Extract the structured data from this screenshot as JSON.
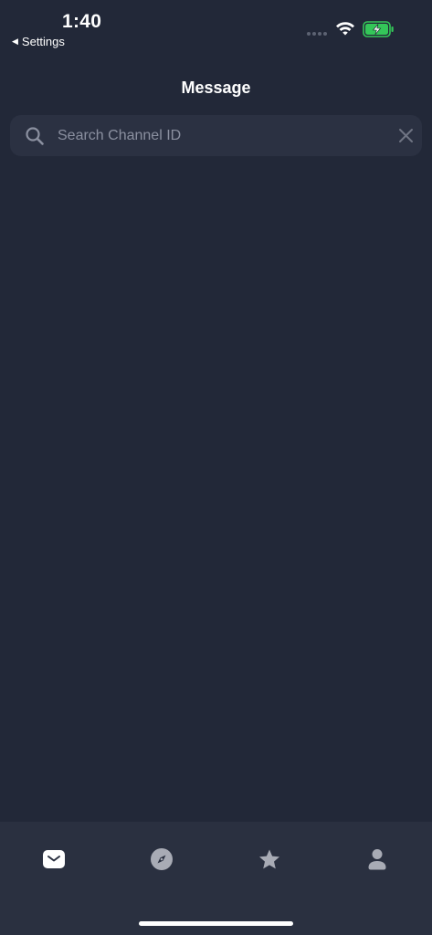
{
  "status_bar": {
    "time": "1:40",
    "back_label": "Settings",
    "back_arrow": "◀",
    "icons": [
      "signal-dots-icon",
      "wifi-icon",
      "battery-charging-icon"
    ]
  },
  "nav": {
    "title": "Message"
  },
  "search": {
    "placeholder": "Search Channel ID",
    "value": "",
    "icon": "search-icon",
    "clear_icon": "close-icon"
  },
  "tabs": [
    {
      "icon": "mail-icon",
      "active": true
    },
    {
      "icon": "compass-icon",
      "active": false
    },
    {
      "icon": "star-icon",
      "active": false
    },
    {
      "icon": "person-icon",
      "active": false
    }
  ],
  "colors": {
    "background": "#222838",
    "search_background": "#2b3142",
    "tab_bar_background": "#2a3040",
    "tab_active": "#ffffff",
    "tab_inactive": "#a8abb5",
    "battery_green": "#34c759"
  }
}
